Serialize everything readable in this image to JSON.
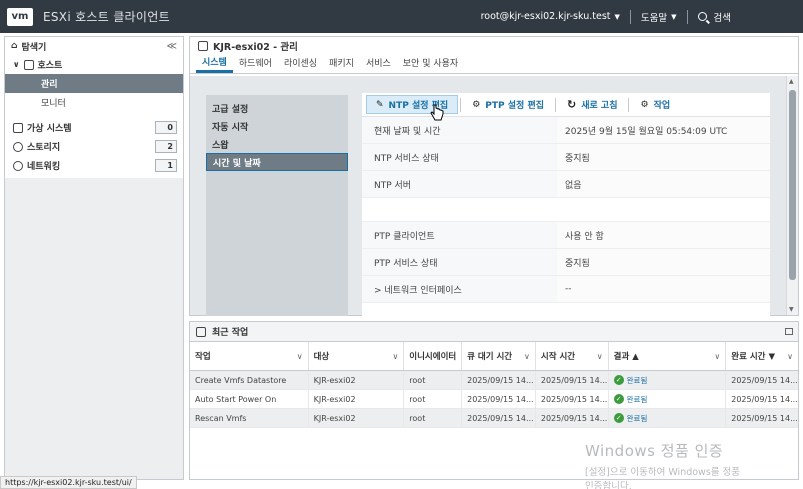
{
  "app": {
    "logo": "vm",
    "title": "ESXi 호스트 클라이언트"
  },
  "topbar": {
    "user": "root@kjr-esxi02.kjr-sku.test",
    "help": "도움말",
    "search": "검색"
  },
  "nav": {
    "header": "탐색기",
    "collapse": "≪",
    "host": "호스트",
    "host_children": [
      "관리",
      "모니터"
    ],
    "items": [
      {
        "label": "가상 시스템",
        "count": "0",
        "icon": "vm-icon"
      },
      {
        "label": "스토리지",
        "count": "2",
        "icon": "storage-icon"
      },
      {
        "label": "네트워킹",
        "count": "1",
        "icon": "network-icon"
      }
    ]
  },
  "main": {
    "title": "KJR-esxi02 - 관리",
    "tabs": [
      "시스템",
      "하드웨어",
      "라이센싱",
      "패키지",
      "서비스",
      "보안 및 사용자"
    ],
    "subnav": [
      "고급 설정",
      "자동 시작",
      "스왑",
      "시간 및 날짜"
    ],
    "toolbar": {
      "ntp_edit": "NTP 설정 편집",
      "ptp_edit": "PTP 설정 편집",
      "refresh": "새로 고침",
      "actions": "작업"
    },
    "details": [
      {
        "key": "현재 날짜 및 시간",
        "value": "2025년 9월 15일 월요일 05:54:09 UTC"
      },
      {
        "key": "NTP 서비스 상태",
        "value": "중지됨"
      },
      {
        "key": "NTP 서버",
        "value": "없음"
      },
      {
        "key": "PTP 클라이언트",
        "value": "사용 안 함"
      },
      {
        "key": "PTP 서비스 상태",
        "value": "중지됨"
      },
      {
        "key": "> 네트워크 인터페이스",
        "value": "--"
      }
    ]
  },
  "tasks": {
    "title": "최근 작업",
    "columns": [
      "작업",
      "대상",
      "이니시에이터",
      "큐 대기 시간",
      "시작 시간",
      "결과 ▲",
      "완료 시간 ▼"
    ],
    "rows": [
      {
        "task": "Create Vmfs Datastore",
        "target": "KJR-esxi02",
        "initiator": "root",
        "queued": "2025/09/15 14...",
        "started": "2025/09/15 14...",
        "result": "완료됨",
        "completed": "2025/09/15 14..."
      },
      {
        "task": "Auto Start Power On",
        "target": "KJR-esxi02",
        "initiator": "root",
        "queued": "2025/09/15 14...",
        "started": "2025/09/15 14...",
        "result": "완료됨",
        "completed": "2025/09/15 14..."
      },
      {
        "task": "Rescan Vmfs",
        "target": "KJR-esxi02",
        "initiator": "root",
        "queued": "2025/09/15 14...",
        "started": "2025/09/15 14...",
        "result": "완료됨",
        "completed": "2025/09/15 14..."
      }
    ]
  },
  "watermark": {
    "line1": "Windows 정품 인증",
    "line2": "[설정]으로 이동하여 Windows를 정품",
    "line3": "인증합니다."
  },
  "status_url": "https://kjr-esxi02.kjr-sku.test/ui/"
}
